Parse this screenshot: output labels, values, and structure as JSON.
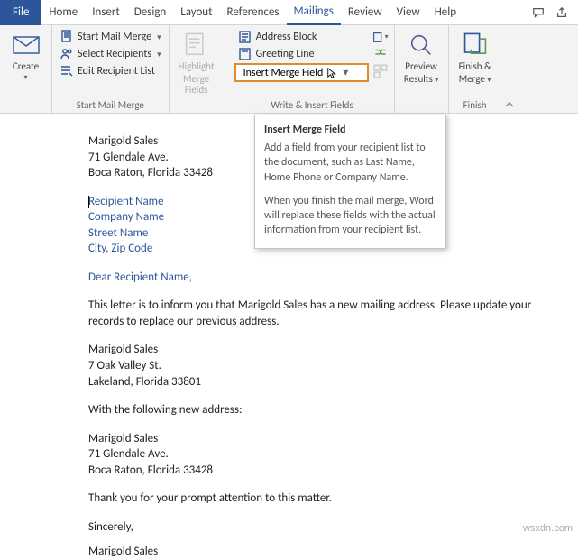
{
  "tabs": {
    "file": "File",
    "items": [
      "Home",
      "Insert",
      "Design",
      "Layout",
      "References",
      "Mailings",
      "Review",
      "View",
      "Help"
    ],
    "active": "Mailings"
  },
  "ribbon": {
    "create": {
      "label": "Create"
    },
    "start_group": {
      "label": "Start Mail Merge",
      "start": "Start Mail Merge",
      "select": "Select Recipients",
      "edit": "Edit Recipient List"
    },
    "highlight": {
      "line1": "Highlight",
      "line2": "Merge Fields"
    },
    "write_group": {
      "label": "Write & Insert Fields",
      "address": "Address Block",
      "greeting": "Greeting Line",
      "insert": "Insert Merge Field"
    },
    "preview": {
      "line1": "Preview",
      "line2": "Results"
    },
    "finish": {
      "group_label": "Finish",
      "line1": "Finish &",
      "line2": "Merge"
    }
  },
  "tooltip": {
    "title": "Insert Merge Field",
    "p1": "Add a field from your recipient list to the document, such as Last Name, Home Phone or Company Name.",
    "p2": "When you finish the mail merge, Word will replace these fields with the actual information from your recipient list."
  },
  "doc": {
    "sender": {
      "name": "Marigold Sales",
      "street": "71 Glendale Ave.",
      "city": "Boca Raton, Florida 33428"
    },
    "fields": {
      "recipient": "Recipient Name",
      "company": "Company Name",
      "street": "Street Name",
      "city": "City, Zip Code"
    },
    "salutation": "Dear Recipient Name,",
    "body1": "This letter is to inform you that Marigold Sales has a new mailing address. Please update your records to replace our previous address.",
    "old": {
      "name": "Marigold Sales",
      "street": "7 Oak Valley St.",
      "city": "Lakeland, Florida 33801"
    },
    "followup": "With the following new address:",
    "newaddr": {
      "name": "Marigold Sales",
      "street": "71 Glendale Ave.",
      "city": "Boca Raton, Florida 33428"
    },
    "thanks": "Thank you for your prompt attention to this matter.",
    "closing": "Sincerely,",
    "signature": "Marigold Sales"
  },
  "watermark": "wsxdn.com"
}
